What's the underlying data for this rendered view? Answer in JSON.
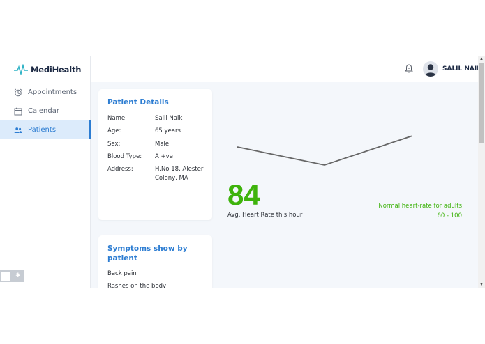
{
  "brand": {
    "name": "MediHealth"
  },
  "sidebar": {
    "items": [
      {
        "label": "Appointments",
        "icon": "alarm-clock-icon",
        "active": false
      },
      {
        "label": "Calendar",
        "icon": "calendar-icon",
        "active": false
      },
      {
        "label": "Patients",
        "icon": "users-icon",
        "active": true
      }
    ]
  },
  "header": {
    "username": "SALIL NAIK",
    "notification_icon": "bell-icon"
  },
  "patient_details": {
    "title": "Patient Details",
    "rows": [
      {
        "label": "Name:",
        "value": "Salil Naik"
      },
      {
        "label": "Age:",
        "value": "65 years"
      },
      {
        "label": "Sex:",
        "value": "Male"
      },
      {
        "label": "Blood Type:",
        "value": "A +ve"
      },
      {
        "label": "Address:",
        "value": "H.No 18, Alester Colony, MA"
      }
    ]
  },
  "symptoms": {
    "title": "Symptoms show by patient",
    "items": [
      "Back pain",
      "Rashes on the body"
    ]
  },
  "heart_rate": {
    "value": "84",
    "label": "Avg. Heart Rate this hour",
    "normal_label": "Normal heart-rate for adults",
    "normal_range": "60 - 100"
  },
  "chart_data": {
    "type": "line",
    "series": [
      {
        "values": [
          80,
          70,
          86
        ]
      }
    ],
    "ylim": [
      65,
      90
    ],
    "grid": false,
    "line_color": "#666666"
  },
  "colors": {
    "accent": "#2d7dd2",
    "good": "#3eb30c"
  }
}
